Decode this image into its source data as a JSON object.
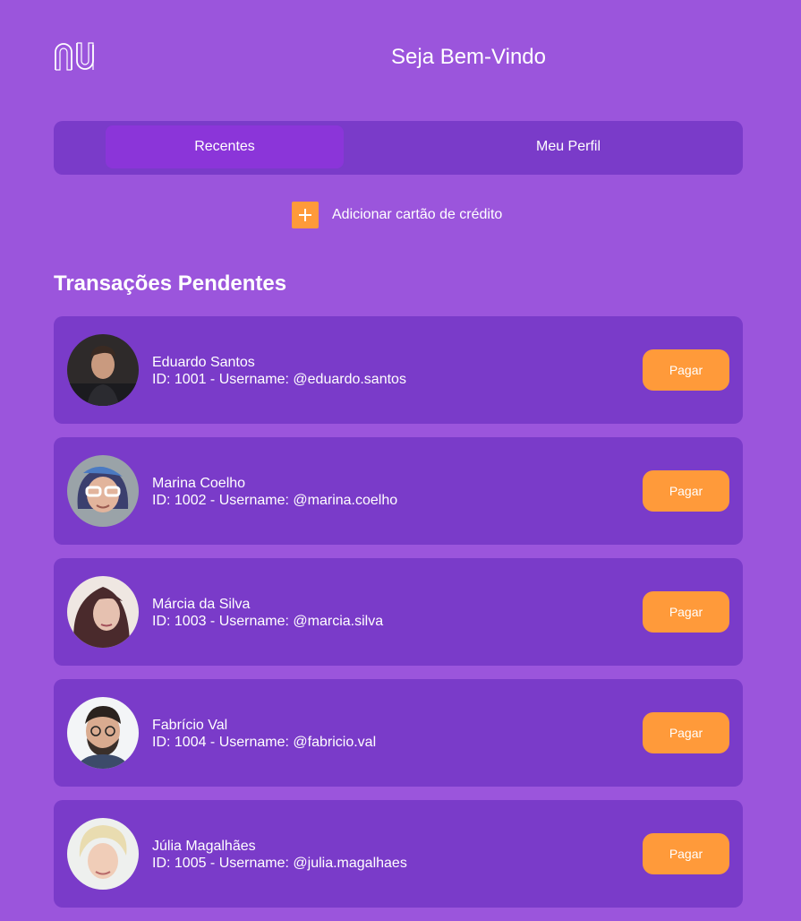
{
  "header": {
    "logo_icon": "nubank-logo-icon",
    "title": "Seja Bem-Vindo"
  },
  "tabs": [
    {
      "label": "Recentes",
      "active": true
    },
    {
      "label": "Meu Perfil",
      "active": false
    }
  ],
  "add_card": {
    "icon": "plus-icon",
    "label": "Adicionar cartão de crédito"
  },
  "section": {
    "title": "Transações Pendentes"
  },
  "transactions": [
    {
      "name": "Eduardo Santos",
      "details": "ID: 1001 - Username: @eduardo.santos",
      "button": "Pagar"
    },
    {
      "name": "Marina Coelho",
      "details": "ID: 1002 - Username: @marina.coelho",
      "button": "Pagar"
    },
    {
      "name": "Márcia da Silva",
      "details": "ID: 1003 - Username: @marcia.silva",
      "button": "Pagar"
    },
    {
      "name": "Fabrício Val",
      "details": "ID: 1004 - Username: @fabricio.val",
      "button": "Pagar"
    },
    {
      "name": "Júlia Magalhães",
      "details": "ID: 1005 - Username: @julia.magalhaes",
      "button": "Pagar"
    }
  ],
  "colors": {
    "background": "#9b55dc",
    "panel": "#7a3bc9",
    "active_tab": "#8b35d9",
    "accent": "#ff9a3a"
  }
}
